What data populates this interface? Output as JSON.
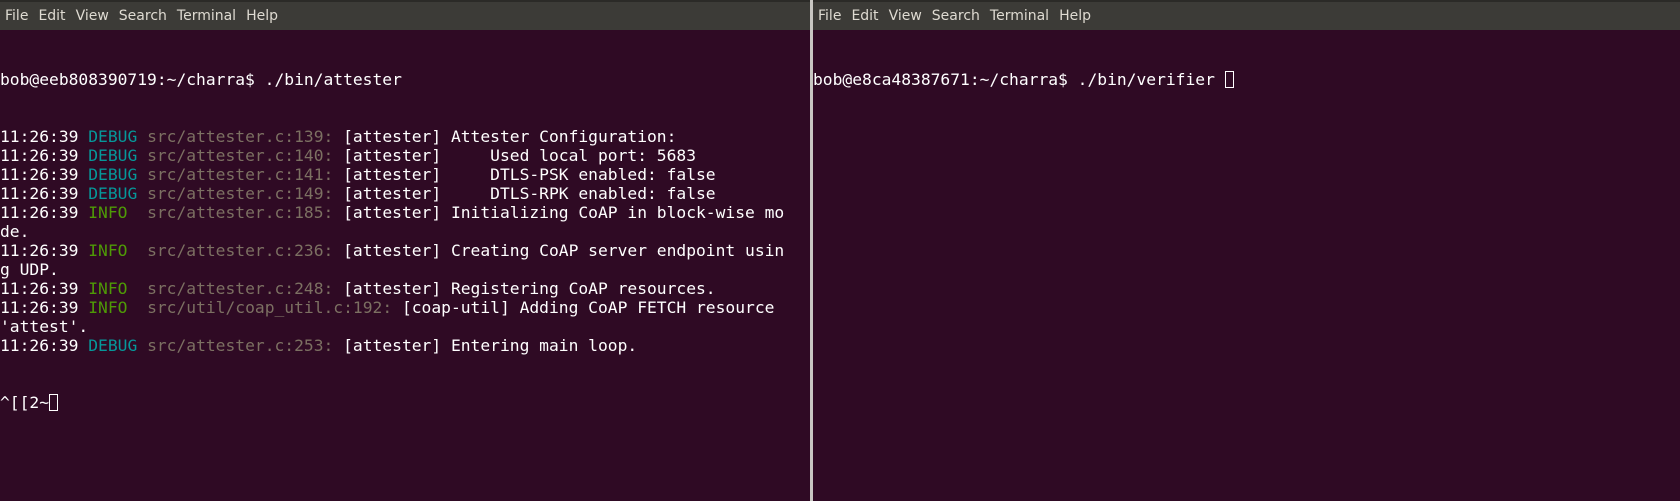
{
  "menu": [
    "File",
    "Edit",
    "View",
    "Search",
    "Terminal",
    "Help"
  ],
  "left_terminal": {
    "prompt": "bob@eeb808390719:~/charra$ ./bin/attester",
    "log": [
      {
        "time": "11:26:39",
        "level": "DEBUG",
        "src": "src/attester.c:139:",
        "text": "[attester] Attester Configuration:"
      },
      {
        "time": "11:26:39",
        "level": "DEBUG",
        "src": "src/attester.c:140:",
        "text": "[attester]     Used local port: 5683"
      },
      {
        "time": "11:26:39",
        "level": "DEBUG",
        "src": "src/attester.c:141:",
        "text": "[attester]     DTLS-PSK enabled: false"
      },
      {
        "time": "11:26:39",
        "level": "DEBUG",
        "src": "src/attester.c:149:",
        "text": "[attester]     DTLS-RPK enabled: false"
      },
      {
        "time": "11:26:39",
        "level": "INFO ",
        "src": "src/attester.c:185:",
        "text": "[attester] Initializing CoAP in block-wise mo",
        "cont": "de."
      },
      {
        "time": "11:26:39",
        "level": "INFO ",
        "src": "src/attester.c:236:",
        "text": "[attester] Creating CoAP server endpoint usin",
        "cont": "g UDP."
      },
      {
        "time": "11:26:39",
        "level": "INFO ",
        "src": "src/attester.c:248:",
        "text": "[attester] Registering CoAP resources."
      },
      {
        "time": "11:26:39",
        "level": "INFO ",
        "src": "src/util/coap_util.c:192:",
        "text": "[coap-util] Adding CoAP FETCH resource",
        "cont": "'attest'."
      },
      {
        "time": "11:26:39",
        "level": "DEBUG",
        "src": "src/attester.c:253:",
        "text": "[attester] Entering main loop."
      }
    ],
    "input_line": "^[[2~"
  },
  "right_terminal": {
    "prompt": "bob@e8ca48387671:~/charra$ ./bin/verifier "
  },
  "colors": {
    "background": "#2f0a24",
    "debug": "#06989a",
    "info": "#4e9a06",
    "source": "#7c7062",
    "menubar": "#3c3b37"
  }
}
